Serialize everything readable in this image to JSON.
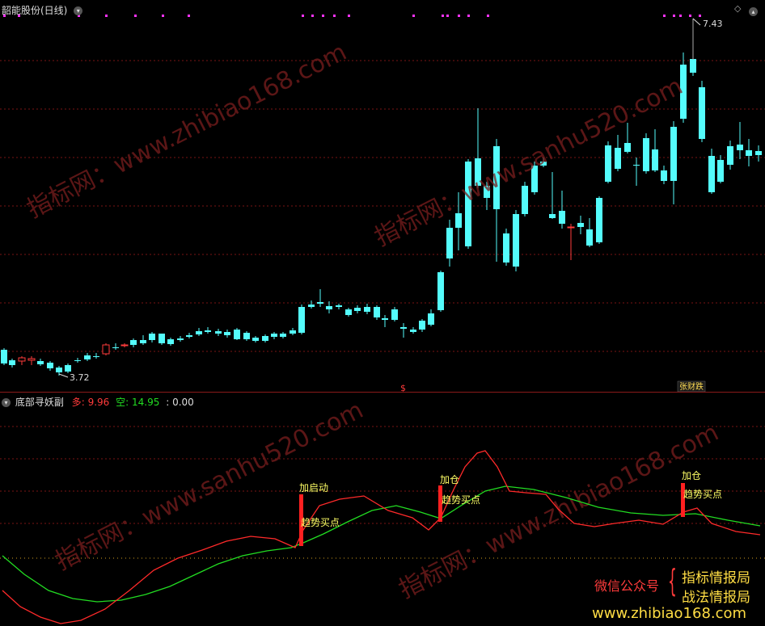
{
  "main_panel": {
    "title": "韶能股份(日线)",
    "high_label": "7.43",
    "low_label": "3.72",
    "dollar_marker": "$",
    "marker_badge": "张财跌",
    "diamond_icon": "diamond-icon"
  },
  "indicator_panel": {
    "title": "底部寻妖副",
    "duo_label": "多",
    "duo_value": "9.96",
    "kong_label": "空",
    "kong_value": "14.95",
    "third_value": "0.00",
    "signals": [
      {
        "top": "加启动",
        "bottom": "趋势买点"
      },
      {
        "top": "加仓",
        "bottom": "趋势买点"
      },
      {
        "top": "加仓",
        "bottom": "趋势买点"
      }
    ]
  },
  "watermark": {
    "line1": "指标网：www.zhibiao168.com",
    "line2": "指标网：www.sanhu520.com",
    "wechat_label": "微信公众号",
    "brand1": "指标情报局",
    "brand2": "战法情报局",
    "site": "www.zhibiao168.com"
  },
  "colors": {
    "up": "#ff3b3b",
    "down": "#54fcfc",
    "grid": "#7a1515",
    "magenta": "#ff33ff",
    "green_line": "#22dd22",
    "yellow_text": "#ffff66"
  }
}
